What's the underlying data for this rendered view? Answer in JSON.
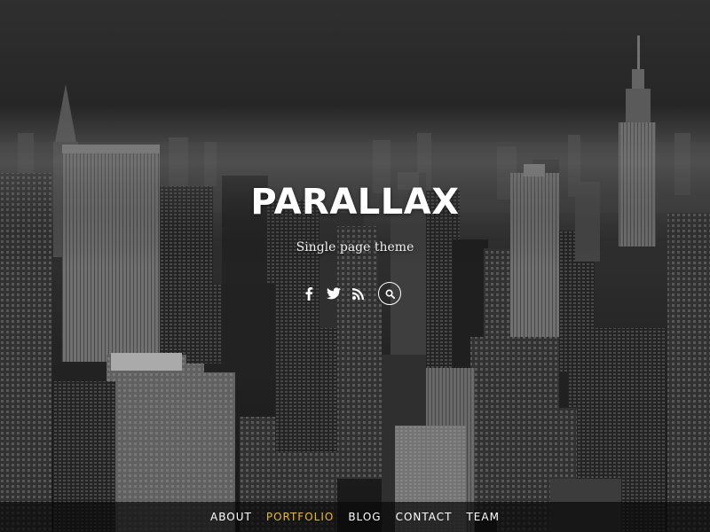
{
  "site": {
    "title": "PARALLAX",
    "tagline": "Single page theme"
  },
  "social": {
    "icons": [
      "facebook-icon",
      "twitter-icon",
      "rss-icon",
      "search-icon"
    ]
  },
  "nav": {
    "items": [
      {
        "label": "ABOUT"
      },
      {
        "label": "PORTFOLIO",
        "active": true
      },
      {
        "label": "BLOG"
      },
      {
        "label": "CONTACT"
      },
      {
        "label": "TEAM"
      }
    ],
    "active_color": "#e9b824"
  },
  "background": {
    "description_colors": {
      "sky": "#3a3a3a",
      "buildings": "#1d1d1d"
    }
  }
}
